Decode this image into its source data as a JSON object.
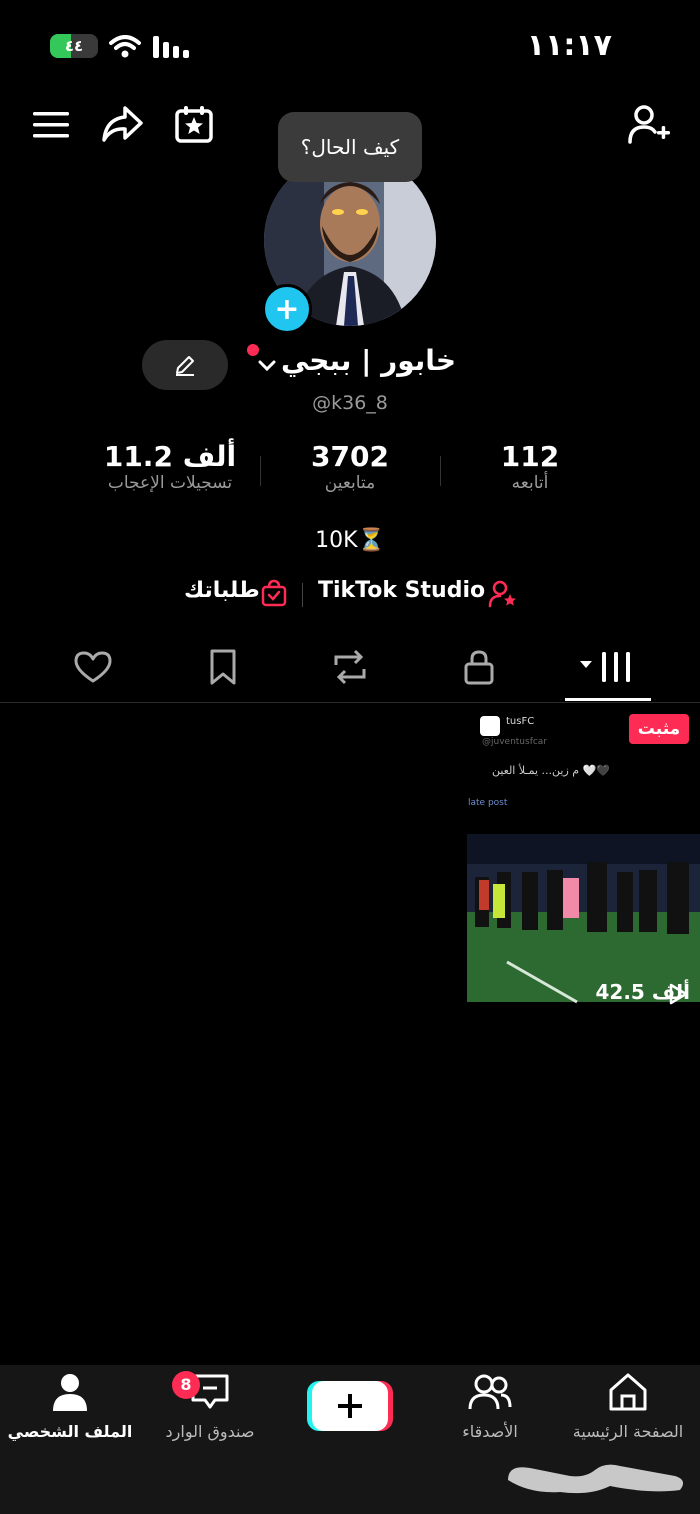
{
  "status_bar": {
    "time": "١١:١٧",
    "battery": "٤٤",
    "battery_level": 0.44
  },
  "header": {
    "menu_icon": "menu-icon",
    "share_icon": "share-icon",
    "calendar_icon": "calendar-star-icon",
    "add_friend_icon": "add-user-icon"
  },
  "profile": {
    "note_bubble": "كيف الحال؟",
    "username": "خابور | ببجي",
    "handle": "@k36_8",
    "bio": "10K⏳"
  },
  "stats": [
    {
      "value": "112",
      "label": "أتابعه"
    },
    {
      "value": "3702",
      "label": "متابعين"
    },
    {
      "value": "11.2 ألف",
      "label": "تسجيلات الإعجاب"
    }
  ],
  "links": {
    "studio": "TikTok Studio",
    "orders": "طلباتك"
  },
  "tabs": [
    "videos",
    "private",
    "reposts",
    "saved",
    "liked"
  ],
  "video": {
    "pinned_label": "مثبت",
    "account": "tusFC",
    "account_sub": "@juventusfcar",
    "caption": "م زين... يمـلأ العين 🤍🖤",
    "sub": "late post",
    "views": "42.5 ألف"
  },
  "bottom_nav": {
    "home": "الصفحة الرئيسية",
    "friends": "الأصدقاء",
    "inbox": "صندوق الوارد",
    "inbox_badge": "8",
    "profile": "الملف الشخصي"
  },
  "watermark": "حراج",
  "colors": {
    "accent": "#fe2c55",
    "cyan": "#25f4ee",
    "plus_badge": "#20c5f0"
  }
}
